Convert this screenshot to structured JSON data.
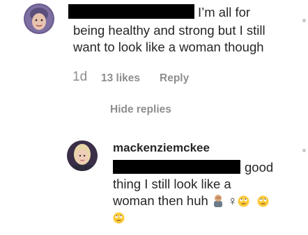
{
  "comment": {
    "text_line1": "I’m all for",
    "text_line2": "being healthy and strong but I still",
    "text_line3": "want to look like a woman though",
    "time_ago": "1d",
    "likes": "13 likes",
    "reply_label": "Reply",
    "hide_replies_label": "Hide replies"
  },
  "reply": {
    "username": "mackenziemckee",
    "text_line1": "good",
    "text_line2": "thing I still look like a",
    "text_line3_text": "woman then huh",
    "emojis": [
      "man-facepalming",
      "female-sign",
      "rolling-eyes-face",
      "rolling-eyes-face",
      "rolling-eyes-face"
    ]
  },
  "colors": {
    "text": "#262626",
    "meta": "#8e8e8e",
    "redaction": "#000000",
    "background": "#ffffff"
  }
}
